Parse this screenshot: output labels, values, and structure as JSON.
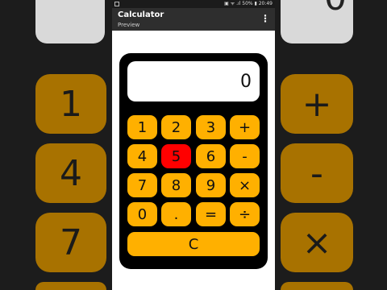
{
  "colors": {
    "key": "#ffb000",
    "key_pressed": "#ff0000",
    "calculator_body": "#000000",
    "appbar": "#2e2e2e"
  },
  "status_bar": {
    "right_text": "▣ ᯤ .ıl 50% ▮ 20:49"
  },
  "app_bar": {
    "title": "Calculator",
    "subtitle": "Preview",
    "menu_icon": "⋮"
  },
  "display": {
    "value": "0"
  },
  "keys": {
    "k1": "1",
    "k2": "2",
    "k3": "3",
    "plus": "+",
    "k4": "4",
    "k5": "5",
    "k6": "6",
    "minus": "-",
    "k7": "7",
    "k8": "8",
    "k9": "9",
    "times": "×",
    "k0": "0",
    "dot": ".",
    "equals": "=",
    "divide": "÷",
    "clear": "C"
  },
  "pressed_key": "5",
  "background": {
    "display_value": "0",
    "left_keys": [
      "1",
      "4",
      "7"
    ],
    "right_keys": [
      "+",
      "-",
      "×"
    ]
  }
}
